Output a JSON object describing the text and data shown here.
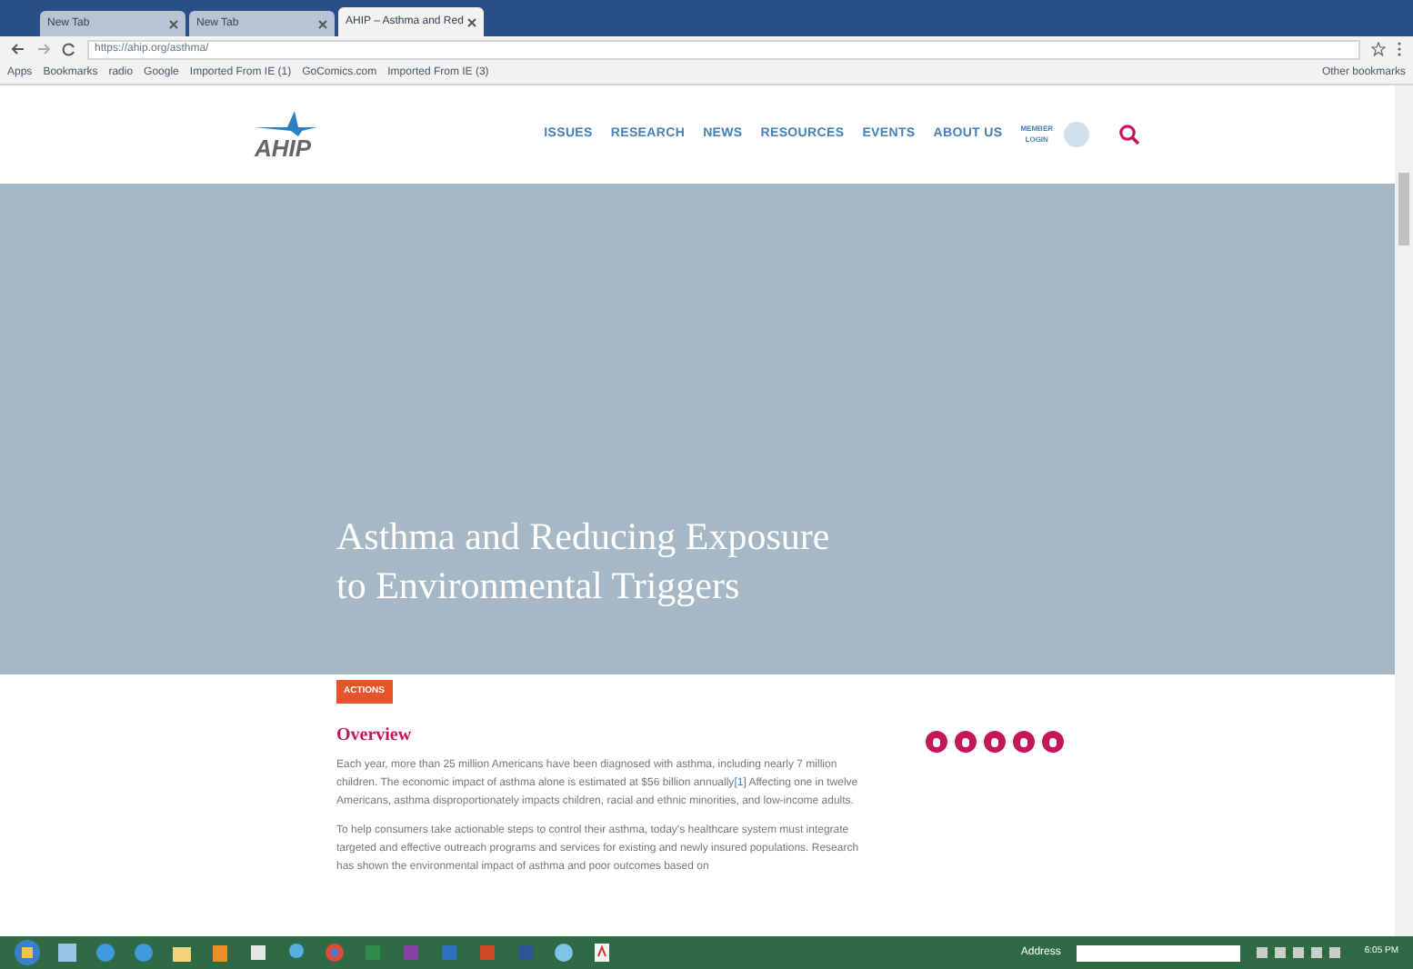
{
  "browser": {
    "tabs": [
      {
        "label": "New Tab",
        "selected": false
      },
      {
        "label": "New Tab",
        "selected": false
      },
      {
        "label": "AHIP – Asthma and Red",
        "selected": true
      }
    ],
    "url": "https://ahip.org/asthma/",
    "bookmarks": [
      "Apps",
      "Bookmarks",
      "radio",
      "Google",
      "Imported From IE (1)",
      "GoComics.com",
      "Imported From IE (3)"
    ],
    "other_bookmarks": "Other bookmarks"
  },
  "site": {
    "logo": "AHIP",
    "nav": [
      "ISSUES",
      "RESEARCH",
      "NEWS",
      "RESOURCES",
      "EVENTS",
      "ABOUT US"
    ],
    "member_login": [
      "MEMBER",
      "LOGIN"
    ]
  },
  "hero": {
    "title": [
      "Asthma and Reducing Exposure",
      "to Environmental Triggers"
    ]
  },
  "content": {
    "tag": "ACTIONS",
    "heading": "Overview",
    "paragraphs": [
      {
        "text": "Each year, more than 25 million Americans have been diagnosed with asthma, including nearly 7 million children.  The economic impact of asthma alone is estimated at $56 billion annually",
        "link": "[1]",
        "rest": " Affecting one in twelve Americans, asthma disproportionately impacts children, racial and ethnic minorities, and low-income adults."
      },
      {
        "text": "To help consumers take actionable steps to control their asthma, today's healthcare system must integrate targeted and effective outreach programs and services for existing and newly insured populations. Research has shown the environmental impact of asthma and poor outcomes based on"
      }
    ]
  },
  "taskbar": {
    "address_label": "Address",
    "time": "6:05 PM"
  }
}
